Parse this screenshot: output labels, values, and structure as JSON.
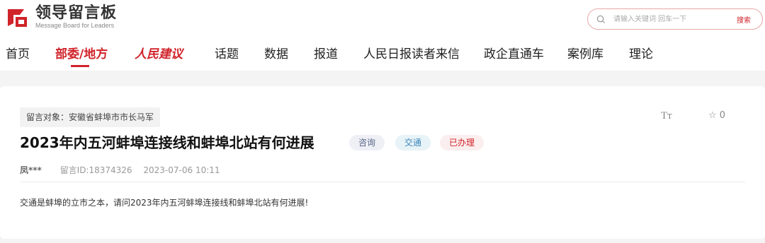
{
  "header": {
    "logo_title": "领导留言板",
    "logo_subtitle": "Message Board for Leaders",
    "search_placeholder": "请输入关键词 回车一下",
    "search_button": "搜索"
  },
  "nav": {
    "items": [
      "首页",
      "部委/地方",
      "人民建议",
      "话题",
      "数据",
      "报道",
      "人民日报读者来信",
      "政企直通车",
      "案例库",
      "理论"
    ],
    "active_index": 1
  },
  "message": {
    "target": "留言对象：安徽省蚌埠市市长马军",
    "title": "2023年内五河蚌埠连接线和蚌埠北站有何进展",
    "tags": [
      "咨询",
      "交通",
      "已办理"
    ],
    "author": "凤***",
    "message_id": "留言ID:18374326",
    "datetime": "2023-07-06 10:11",
    "favorites": "0",
    "font_toggle": "Tт",
    "content": "交通是蚌埠的立市之本，请问2023年内五河蚌埠连接线和蚌埠北站有何进展!"
  },
  "colors": {
    "brand": "#d0232a",
    "background": "#f4f4f4"
  }
}
